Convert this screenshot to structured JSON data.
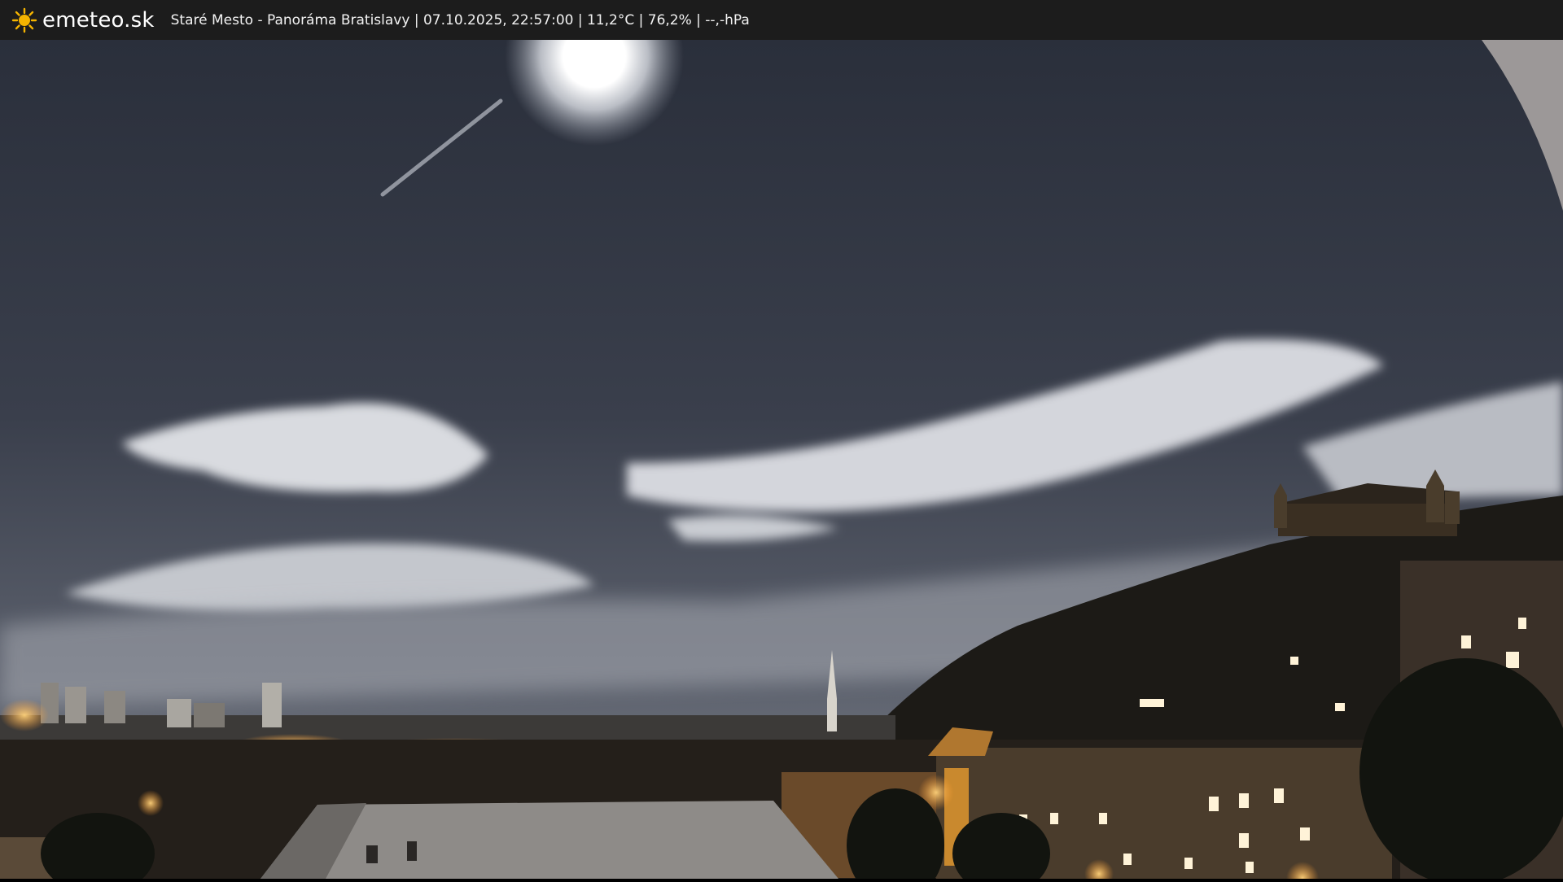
{
  "header": {
    "logo_icon": "sun-icon",
    "brand": "emeteo.sk",
    "caption": "Staré Mesto - Panoráma Bratislavy | 07.10.2025, 22:57:00 | 11,2°C | 76,2% | --,-hPa"
  },
  "colors": {
    "bar": "#1c1c1c",
    "sun": "#f5b400",
    "sky_top": "#2b303d",
    "sky_bottom": "#6f7480",
    "city_light": "#ffb14a"
  }
}
